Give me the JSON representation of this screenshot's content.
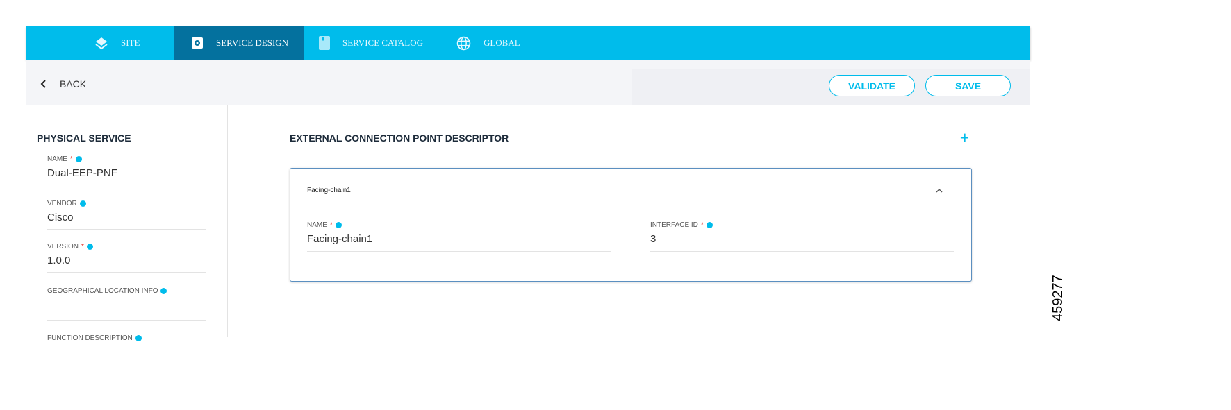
{
  "nav": {
    "tabs": [
      {
        "label": "SITE",
        "icon": "layers-icon"
      },
      {
        "label": "SERVICE DESIGN",
        "icon": "gear-icon",
        "active": true
      },
      {
        "label": "SERVICE CATALOG",
        "icon": "bookmark-icon"
      },
      {
        "label": "GLOBAL",
        "icon": "globe-icon"
      }
    ]
  },
  "toolbar": {
    "back": "BACK",
    "validate": "VALIDATE",
    "save": "SAVE"
  },
  "sidebar": {
    "title": "PHYSICAL SERVICE",
    "fields": [
      {
        "label": "NAME",
        "required": "*",
        "value": "Dual-EEP-PNF"
      },
      {
        "label": "VENDOR",
        "value": "Cisco"
      },
      {
        "label": "VERSION",
        "required": "*",
        "value": "1.0.0"
      },
      {
        "label": "GEOGRAPHICAL LOCATION INFO",
        "value": ""
      },
      {
        "label": "FUNCTION DESCRIPTION"
      }
    ]
  },
  "main": {
    "title": "EXTERNAL CONNECTION POINT DESCRIPTOR",
    "add": "+",
    "card": {
      "title": "Facing-chain1",
      "collapse": "⌃",
      "fields": [
        {
          "label": "NAME",
          "required": "*",
          "value": "Facing-chain1"
        },
        {
          "label": "INTERFACE ID",
          "required": "*",
          "value": "3"
        }
      ]
    }
  },
  "figure_number": "459277",
  "colors": {
    "accent": "#00bceb",
    "active_tab": "#04719e"
  }
}
